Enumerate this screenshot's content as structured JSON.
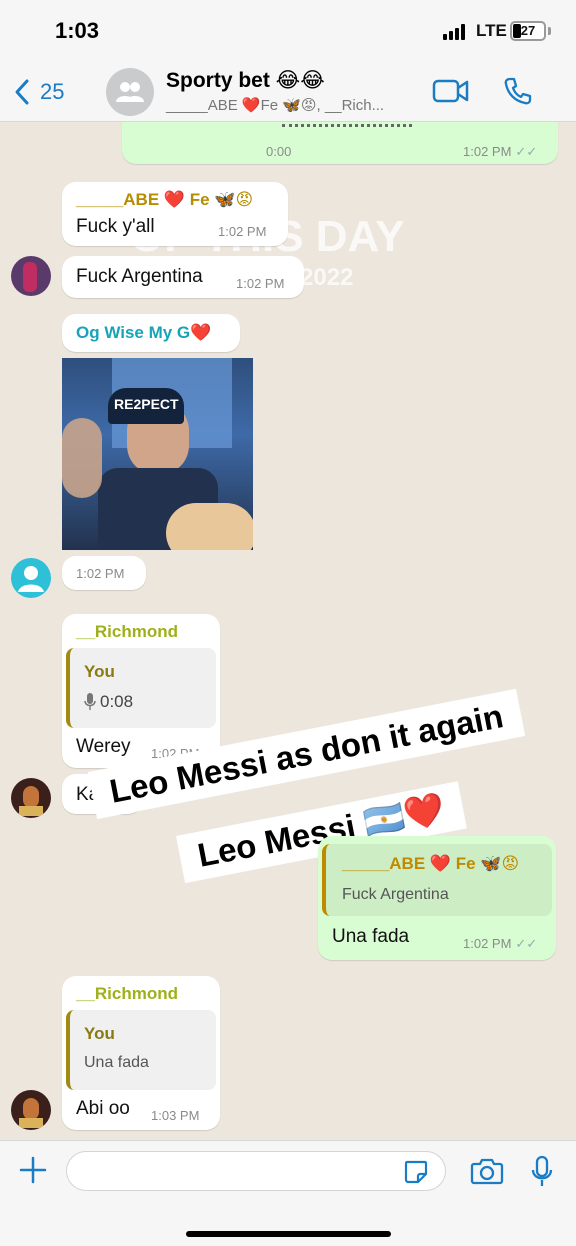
{
  "status_bar": {
    "time": "1:03",
    "network": "LTE",
    "battery": "27"
  },
  "header": {
    "back_count": "25",
    "title": "Sporty bet 😂😂",
    "subtitle": "_____ABE ❤️Fe 🦋😡, __Rich..."
  },
  "watermark": {
    "line1": "OF THIS DAY",
    "line2": "2022"
  },
  "messages": {
    "top_voice": {
      "duration": "0:00",
      "time": "1:02 PM"
    },
    "abe_fuck": {
      "sender": "_____ABE ❤️ Fe 🦋😡",
      "text": "Fuck y'all",
      "time": "1:02 PM"
    },
    "fuck_argentina": {
      "text": "Fuck Argentina",
      "time": "1:02 PM"
    },
    "og_wise": {
      "sender": "Og Wise My G❤️",
      "image_text": "RE2PECT",
      "time": "1:02 PM"
    },
    "richmond_1": {
      "sender": "__Richmond",
      "quote_author": "You",
      "quote_voice": "0:08",
      "text": "Werey",
      "time": "1:02 PM"
    },
    "partial": {
      "text": "Kay"
    },
    "out_reply": {
      "quote_author": "_____ABE ❤️ Fe 🦋😡",
      "quote_text": "Fuck Argentina",
      "text": "Una fada",
      "time": "1:02 PM"
    },
    "richmond_2": {
      "sender": "__Richmond",
      "quote_author": "You",
      "quote_text": "Una fada",
      "text": "Abi oo",
      "time": "1:03 PM"
    }
  },
  "caption": {
    "line1": "Leo Messi as don it again",
    "line2": "Leo Messi 🇦🇷❤️"
  },
  "colors": {
    "accent": "#1a7cc4",
    "sender_abe": "#b68c00",
    "sender_og": "#17a4b8",
    "sender_richmond": "#9fb01a",
    "outgoing_bubble": "#d9fdd3"
  },
  "icons": [
    "back-chevron-icon",
    "group-avatar-icon",
    "video-call-icon",
    "phone-call-icon",
    "plus-icon",
    "sticker-icon",
    "camera-icon",
    "mic-icon"
  ]
}
